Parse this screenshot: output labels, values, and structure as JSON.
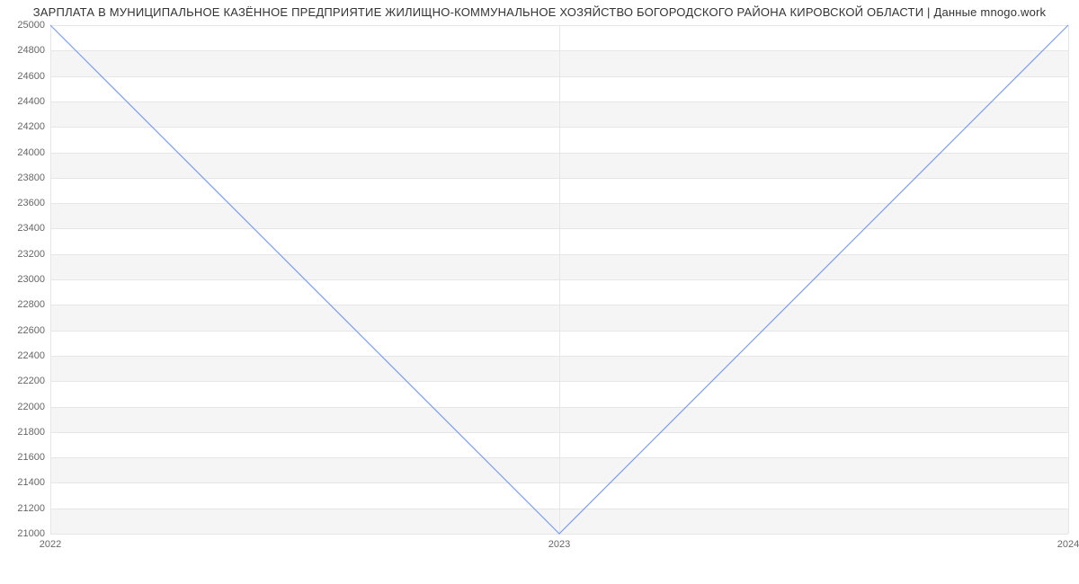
{
  "chart_data": {
    "type": "line",
    "title": "ЗАРПЛАТА В МУНИЦИПАЛЬНОЕ КАЗЁННОЕ ПРЕДПРИЯТИЕ ЖИЛИЩНО-КОММУНАЛЬНОЕ ХОЗЯЙСТВО БОГОРОДСКОГО РАЙОНА КИРОВСКОЙ ОБЛАСТИ | Данные mnogo.work",
    "x": [
      2022,
      2023,
      2024
    ],
    "values": [
      25000,
      21000,
      25000
    ],
    "xlabel": "",
    "ylabel": "",
    "ylim": [
      21000,
      25000
    ],
    "y_ticks": [
      21000,
      21200,
      21400,
      21600,
      21800,
      22000,
      22200,
      22400,
      22600,
      22800,
      23000,
      23200,
      23400,
      23600,
      23800,
      24000,
      24200,
      24400,
      24600,
      24800,
      25000
    ],
    "x_ticks": [
      2022,
      2023,
      2024
    ],
    "line_color": "#7a9ff0",
    "band_color": "#f5f5f5"
  }
}
